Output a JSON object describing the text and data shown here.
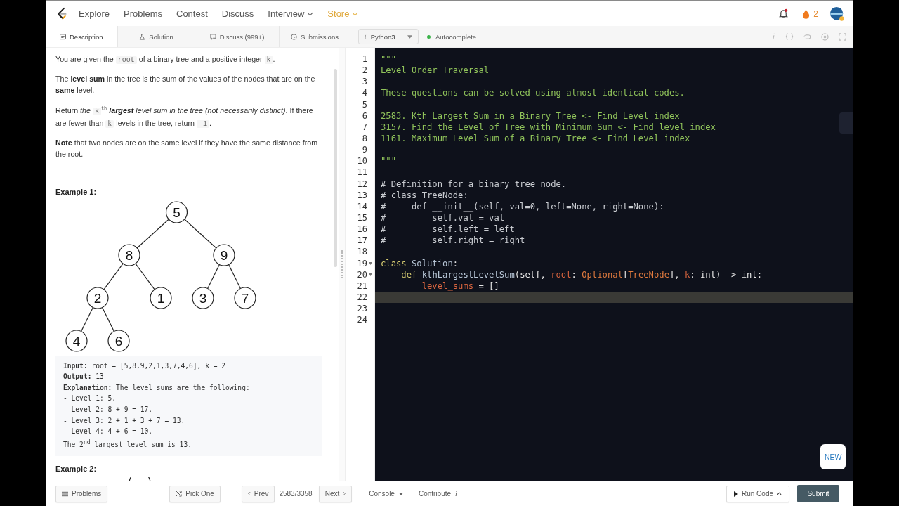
{
  "nav": {
    "links": [
      {
        "label": "Explore",
        "kind": "link"
      },
      {
        "label": "Problems",
        "kind": "link"
      },
      {
        "label": "Contest",
        "kind": "link"
      },
      {
        "label": "Discuss",
        "kind": "link"
      },
      {
        "label": "Interview",
        "kind": "menu"
      },
      {
        "label": "Store",
        "kind": "store"
      }
    ],
    "notifications_unread": true,
    "streak": "2"
  },
  "tabs": [
    {
      "label": "Description",
      "selected": true
    },
    {
      "label": "Solution",
      "selected": false
    },
    {
      "label": "Discuss (999+)",
      "selected": false
    },
    {
      "label": "Submissions",
      "selected": false
    }
  ],
  "language": {
    "info": "i",
    "label": "Python3"
  },
  "autocomplete": {
    "label": "Autocomplete",
    "on": true
  },
  "description": {
    "paragraphs": [
      [
        {
          "text": "You are given the ",
          "kind": "text"
        },
        {
          "text": "root",
          "kind": "code"
        },
        {
          "text": " of a binary tree and a positive integer ",
          "kind": "text"
        },
        {
          "text": "k",
          "kind": "code"
        },
        {
          "text": ".",
          "kind": "text"
        }
      ],
      [
        {
          "text": "The ",
          "kind": "text"
        },
        {
          "text": "level sum",
          "kind": "bold"
        },
        {
          "text": " in the tree is the sum of the values of the nodes that are on the ",
          "kind": "text"
        },
        {
          "text": "same",
          "kind": "bold"
        },
        {
          "text": " level.",
          "kind": "text"
        }
      ],
      [
        {
          "text": "Return ",
          "kind": "text"
        },
        {
          "text": "the ",
          "kind": "italic"
        },
        {
          "text": "k",
          "kind": "code"
        },
        {
          "text": "th",
          "kind": "sup"
        },
        {
          "text": " largest",
          "kind": "bolditalic"
        },
        {
          "text": " level sum in the tree (not necessarily distinct)",
          "kind": "italic"
        },
        {
          "text": ". If there are fewer than ",
          "kind": "text"
        },
        {
          "text": "k",
          "kind": "code"
        },
        {
          "text": " levels in the tree, return ",
          "kind": "text"
        },
        {
          "text": "-1",
          "kind": "code"
        },
        {
          "text": ".",
          "kind": "text"
        }
      ],
      [
        {
          "text": "Note",
          "kind": "bold"
        },
        {
          "text": " that two nodes are on the same level if they have the same distance from the root.",
          "kind": "text"
        }
      ]
    ],
    "example1": {
      "title": "Example 1:",
      "tree": {
        "label": "5",
        "children": [
          {
            "label": "8",
            "children": [
              {
                "label": "2",
                "children": [
                  {
                    "label": "4"
                  },
                  {
                    "label": "6"
                  }
                ]
              },
              {
                "label": "1"
              }
            ]
          },
          {
            "label": "9",
            "children": [
              {
                "label": "3"
              },
              {
                "label": "7"
              }
            ]
          }
        ]
      },
      "lines": [
        "**Input:** root = [5,8,9,2,1,3,7,4,6], k = 2",
        "**Output:** 13",
        "**Explanation:** The level sums are the following:",
        "- Level 1: 5.",
        "- Level 2: 8 + 9 = 17.",
        "- Level 3: 2 + 1 + 3 + 7 = 13.",
        "- Level 4: 4 + 6 = 10.",
        "The 2$^{nd}$ largest level sum is 13."
      ]
    },
    "example2_title": "Example 2:"
  },
  "editor": {
    "lines": [
      {
        "number": "1",
        "fold": false,
        "highlighted": false,
        "tokens": [
          {
            "text": "\"\"\"",
            "kind": "str"
          }
        ]
      },
      {
        "number": "2",
        "fold": false,
        "highlighted": false,
        "tokens": [
          {
            "text": "Level Order Traversal",
            "kind": "str"
          }
        ]
      },
      {
        "number": "3",
        "fold": false,
        "highlighted": false
      },
      {
        "number": "4",
        "fold": false,
        "highlighted": false,
        "tokens": [
          {
            "text": "These questions can be solved using almost identical codes.",
            "kind": "str"
          }
        ]
      },
      {
        "number": "5",
        "fold": false,
        "highlighted": false
      },
      {
        "number": "6",
        "fold": false,
        "highlighted": false,
        "tokens": [
          {
            "text": "2583. Kth Largest Sum in a Binary Tree <- Find Level index",
            "kind": "str"
          }
        ]
      },
      {
        "number": "7",
        "fold": false,
        "highlighted": false,
        "tokens": [
          {
            "text": "3157. Find the Level of Tree with Minimum Sum <- Find level index",
            "kind": "str"
          }
        ]
      },
      {
        "number": "8",
        "fold": false,
        "highlighted": false,
        "tokens": [
          {
            "text": "1161. Maximum Level Sum of a Binary Tree <- Find Level index",
            "kind": "str"
          }
        ]
      },
      {
        "number": "9",
        "fold": false,
        "highlighted": false
      },
      {
        "number": "10",
        "fold": false,
        "highlighted": false,
        "tokens": [
          {
            "text": "\"\"\"",
            "kind": "str"
          }
        ]
      },
      {
        "number": "11",
        "fold": false,
        "highlighted": false
      },
      {
        "number": "12",
        "fold": false,
        "highlighted": false,
        "tokens": [
          {
            "text": "# Definition for a binary tree node.",
            "kind": "comment"
          }
        ]
      },
      {
        "number": "13",
        "fold": false,
        "highlighted": false,
        "tokens": [
          {
            "text": "# class TreeNode:",
            "kind": "comment"
          }
        ]
      },
      {
        "number": "14",
        "fold": false,
        "highlighted": false,
        "tokens": [
          {
            "text": "#     def __init__(self, val=0, left=None, right=None):",
            "kind": "comment"
          }
        ]
      },
      {
        "number": "15",
        "fold": false,
        "highlighted": false,
        "tokens": [
          {
            "text": "#         self.val = val",
            "kind": "comment"
          }
        ]
      },
      {
        "number": "16",
        "fold": false,
        "highlighted": false,
        "tokens": [
          {
            "text": "#         self.left = left",
            "kind": "comment"
          }
        ]
      },
      {
        "number": "17",
        "fold": false,
        "highlighted": false,
        "tokens": [
          {
            "text": "#         self.right = right",
            "kind": "comment"
          }
        ]
      },
      {
        "number": "18",
        "fold": false,
        "highlighted": false
      },
      {
        "number": "19",
        "fold": true,
        "highlighted": false,
        "tokens": [
          {
            "text": "class",
            "kind": "kw"
          },
          {
            "text": " Solution",
            "kind": "fn"
          },
          {
            "text": ":",
            "kind": "plain"
          }
        ]
      },
      {
        "number": "20",
        "fold": true,
        "highlighted": false,
        "tokens": [
          {
            "text": "    def",
            "kind": "kw"
          },
          {
            "text": " kthLargestLevelSum",
            "kind": "fn"
          },
          {
            "text": "(self, ",
            "kind": "plain"
          },
          {
            "text": "root",
            "kind": "var"
          },
          {
            "text": ": ",
            "kind": "plain"
          },
          {
            "text": "Optional",
            "kind": "type"
          },
          {
            "text": "[",
            "kind": "plain"
          },
          {
            "text": "TreeNode",
            "kind": "type"
          },
          {
            "text": "], ",
            "kind": "plain"
          },
          {
            "text": "k",
            "kind": "var"
          },
          {
            "text": ": int) -> int:",
            "kind": "plain"
          }
        ]
      },
      {
        "number": "21",
        "fold": false,
        "highlighted": false,
        "tokens": [
          {
            "text": "        level_sums",
            "kind": "var"
          },
          {
            "text": " = []",
            "kind": "plain"
          }
        ]
      },
      {
        "number": "22",
        "fold": false,
        "highlighted": true
      },
      {
        "number": "23",
        "fold": false,
        "highlighted": false
      },
      {
        "number": "24",
        "fold": false,
        "highlighted": false
      }
    ]
  },
  "new_badge": "NEW",
  "footer": {
    "problems": "Problems",
    "pick_one": "Pick One",
    "prev": "Prev",
    "counter": "2583/3358",
    "next": "Next",
    "console": "Console",
    "contribute": "Contribute",
    "contribute_info": "i",
    "run_code": "Run Code",
    "submit": "Submit"
  }
}
